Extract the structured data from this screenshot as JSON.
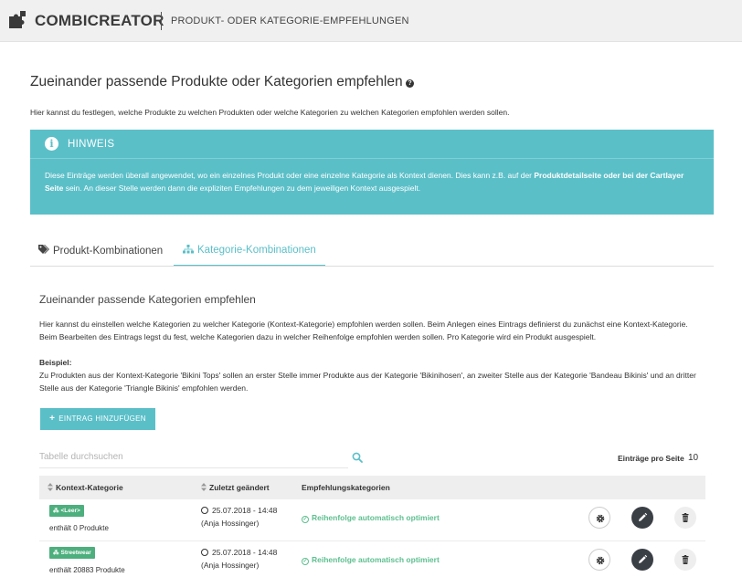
{
  "header": {
    "brand": "COMBICREATOR",
    "subtitle": "PRODUKT- ODER KATEGORIE-EMPFEHLUNGEN"
  },
  "page": {
    "title": "Zueinander passende Produkte oder Kategorien empfehlen",
    "intro": "Hier kannst du festlegen, welche Produkte zu welchen Produkten oder welche Kategorien zu welchen Kategorien empfohlen werden sollen."
  },
  "hint": {
    "title": "HINWEIS",
    "text_1": "Diese Einträge werden überall angewendet, wo ein einzelnes Produkt oder eine einzelne Kategorie als Kontext dienen. Dies kann z.B. auf der ",
    "text_bold": "Produktdetailseite oder bei der Cartlayer Seite",
    "text_2": " sein. An dieser Stelle werden dann die expliziten Empfehlungen zu dem jeweiligen Kontext ausgespielt."
  },
  "tabs": [
    {
      "label": "Produkt-Kombinationen"
    },
    {
      "label": "Kategorie-Kombinationen"
    }
  ],
  "section": {
    "title": "Zueinander passende Kategorien empfehlen",
    "description": "Hier kannst du einstellen welche Kategorien zu welcher Kategorie (Kontext-Kategorie) empfohlen werden sollen. Beim Anlegen eines Eintrags definierst du zunächst eine Kontext-Kategorie. Beim Bearbeiten des Eintrags legst du fest, welche Kategorien dazu in welcher Reihenfolge empfohlen werden sollen. Pro Kategorie wird ein Produkt ausgespielt.",
    "example_label": "Beispiel:",
    "example_text": "Zu Produkten aus der Kontext-Kategorie 'Bikini Tops' sollen an erster Stelle immer Produkte aus der Kategorie 'Bikinihosen', an zweiter Stelle aus der Kategorie 'Bandeau Bikinis' und an dritter Stelle aus der Kategorie 'Triangle Bikinis' empfohlen werden.",
    "add_button": "EINTRAG HINZUFÜGEN"
  },
  "table": {
    "search_placeholder": "Tabelle durchsuchen",
    "per_page_label": "Einträge pro Seite",
    "per_page_value": "10",
    "columns": [
      "Kontext-Kategorie",
      "Zuletzt geändert",
      "Empfehlungskategorien"
    ],
    "rows": [
      {
        "tag": "<Leer>",
        "count": "enthält 0 Produkte",
        "date": "25.07.2018 - 14:48",
        "author": "(Anja Hossinger)",
        "status": "Reihenfolge automatisch optimiert"
      },
      {
        "tag": "Streetwear",
        "count": "enthält 20883 Produkte",
        "date": "25.07.2018 - 14:48",
        "author": "(Anja Hossinger)",
        "status": "Reihenfolge automatisch optimiert"
      }
    ]
  },
  "colors": {
    "accent": "#5bbfc8",
    "tag": "#4caf7d",
    "status": "#5dbf8f",
    "dark_button": "#3a3f46"
  },
  "icons": [
    "puzzle-icon",
    "help-icon",
    "info-icon",
    "tags-icon",
    "sitemap-icon",
    "plus-icon",
    "search-icon",
    "sort-icon",
    "clock-icon",
    "check-circle-icon",
    "gear-icon",
    "pencil-icon",
    "trash-icon"
  ]
}
